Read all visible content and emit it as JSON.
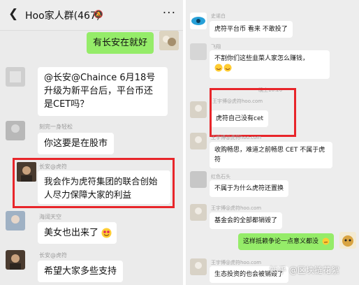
{
  "left_chat": {
    "header": {
      "back_icon": "chevron-left-icon",
      "title": "Hoo家人群(467)",
      "mute_icon": "bell-mute-icon",
      "more_icon": "more-dots-icon"
    },
    "messages": [
      {
        "text": "有长安在就好"
      },
      {
        "text": "@长安@Chaince 6月18号升级为新平台后，平台币还是CET吗？"
      },
      {
        "sender": "刻完一身轻松",
        "text": "你这要是在股市"
      },
      {
        "sender": "长安@虎符",
        "text": "我会作为虎符集团的联合创始人尽力保障大家的利益"
      },
      {
        "sender": "海阔天空",
        "text": "美女也出来了"
      },
      {
        "sender": "长安@虎符",
        "text": "希望大家多些支持"
      }
    ]
  },
  "right_chat": {
    "messages": [
      {
        "sender": "史诺白",
        "text": "虎符平台币 看来 不敢投了"
      },
      {
        "sender": "飞翔",
        "text": "不割你们这些韭菜人家怎么赚钱，"
      },
      {
        "time": "晚上10:20"
      },
      {
        "sender": "王宇博@虎符hoo.com",
        "text": "虎符自己没有cet"
      },
      {
        "sender": "王宇博@虎符hoo.com",
        "text": "收购畅思，难道之前畅思 CET 不属于虎符"
      },
      {
        "sender": "红色石头",
        "text": "不属于为什么虎符还置换"
      },
      {
        "sender": "王宇博@虎符hoo.com",
        "text": "基金会的全部都销毁了"
      },
      {
        "text": "这样抵赖争论一点意义都没"
      },
      {
        "sender": "王宇博@虎符hoo.com",
        "text": "生态投资的也会被销毁了"
      }
    ]
  },
  "watermark": "知乎 @区块链花絮",
  "colors": {
    "accent_red": "#e8252a",
    "bubble_green": "#95ec69",
    "background": "#ebebeb"
  }
}
